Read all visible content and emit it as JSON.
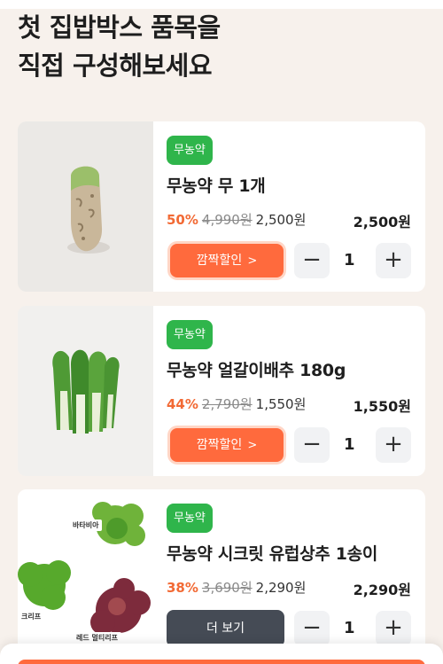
{
  "headline": {
    "line1": "첫 집밥박스 품목을",
    "line2": "직접 구성해보세요"
  },
  "products": [
    {
      "badge": "무농약",
      "name": "무농약 무 1개",
      "discount": "50%",
      "original_price": "4,990원",
      "sale_price": "2,500원",
      "total": "2,500원",
      "action_label": "깜짝할인",
      "action_icon": "chevron-right-icon",
      "quantity": "1",
      "image": "radish-photo"
    },
    {
      "badge": "무농약",
      "name": "무농약 얼갈이배추 180g",
      "discount": "44%",
      "original_price": "2,790원",
      "sale_price": "1,550원",
      "total": "1,550원",
      "action_label": "깜짝할인",
      "action_icon": "chevron-right-icon",
      "quantity": "1",
      "image": "cabbage-photo"
    },
    {
      "badge": "무농약",
      "name": "무농약 시크릿 유럽상추 1송이",
      "discount": "38%",
      "original_price": "3,690원",
      "sale_price": "2,290원",
      "total": "2,290원",
      "action_label": "더 보기",
      "quantity": "1",
      "image": "lettuce-photo",
      "image_labels": [
        "바타비아",
        "크리프",
        "레드 멀티리프"
      ]
    }
  ],
  "stepper": {
    "minus": "−",
    "plus": "+"
  },
  "colors": {
    "background": "#f7f1ec",
    "badge_green": "#2fb54b",
    "discount_orange": "#f26a35",
    "promo_button": "#ff6a3d",
    "more_button": "#454b55"
  }
}
